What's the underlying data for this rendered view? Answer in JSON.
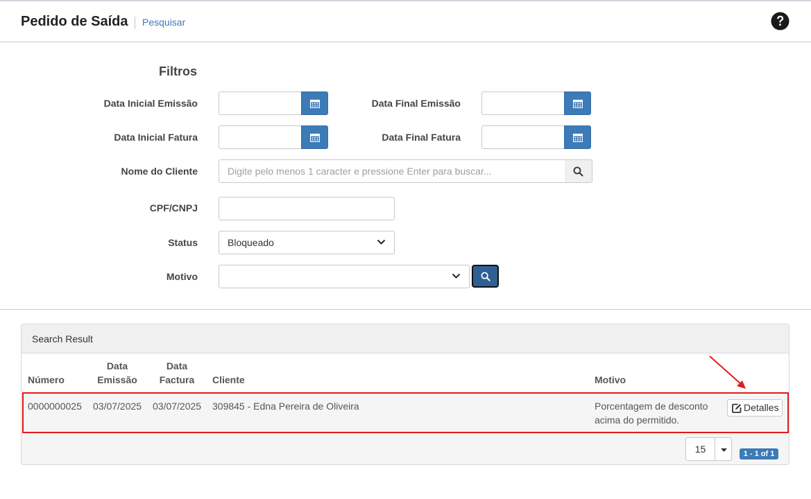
{
  "header": {
    "title": "Pedido de Saída",
    "breadcrumb": "Pesquisar"
  },
  "filters": {
    "title": "Filtros",
    "data_inicial_emissao_label": "Data Inicial Emissão",
    "data_final_emissao_label": "Data Final Emissão",
    "data_inicial_fatura_label": "Data Inicial Fatura",
    "data_final_fatura_label": "Data Final Fatura",
    "nome_cliente_label": "Nome do Cliente",
    "nome_cliente_placeholder": "Digite pelo menos 1 caracter e pressione Enter para buscar...",
    "cpf_cnpj_label": "CPF/CNPJ",
    "status_label": "Status",
    "status_value": "Bloqueado",
    "motivo_label": "Motivo",
    "motivo_value": ""
  },
  "results": {
    "panel_title": "Search Result",
    "columns": {
      "numero": "Número",
      "data_emissao_1": "Data",
      "data_emissao_2": "Emissão",
      "data_factura_1": "Data",
      "data_factura_2": "Factura",
      "cliente": "Cliente",
      "motivo": "Motivo"
    },
    "rows": [
      {
        "numero": "0000000025",
        "data_emissao": "03/07/2025",
        "data_factura": "03/07/2025",
        "cliente": "309845 - Edna Pereira de Oliveira",
        "motivo_line1": "Porcentagem de desconto",
        "motivo_line2": "acima do permitido.",
        "action_label": "Detalles"
      }
    ],
    "page_size": "15",
    "page_info": "1 - 1 of 1"
  },
  "colors": {
    "primary": "#3c7ab8",
    "highlight": "#e01a1a"
  }
}
